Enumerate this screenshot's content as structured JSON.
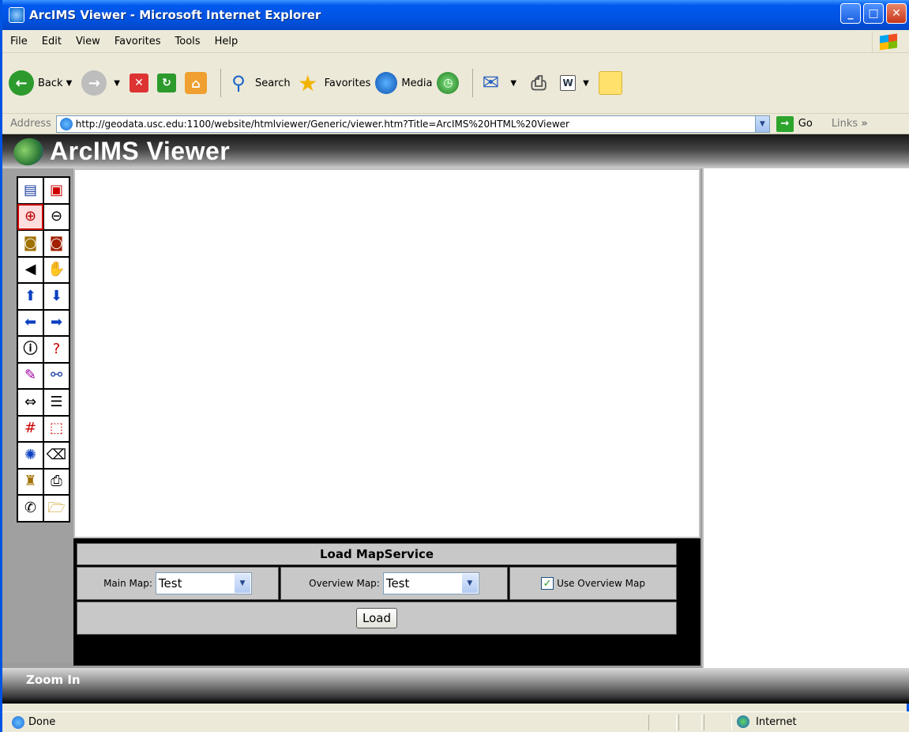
{
  "window": {
    "title": "ArcIMS Viewer - Microsoft Internet Explorer"
  },
  "menu": [
    "File",
    "Edit",
    "View",
    "Favorites",
    "Tools",
    "Help"
  ],
  "toolbar": {
    "back": "Back",
    "search": "Search",
    "favorites": "Favorites",
    "media": "Media"
  },
  "address": {
    "label": "Address",
    "url": "http://geodata.usc.edu:1100/website/htmlviewer/Generic/viewer.htm?Title=ArcIMS%20HTML%20Viewer",
    "go": "Go",
    "links": "Links"
  },
  "viewer": {
    "title": "ArcIMS Viewer",
    "status": "Zoom In"
  },
  "load_panel": {
    "title": "Load MapService",
    "main_map_label": "Main Map:",
    "main_map_value": "Test",
    "overview_map_label": "Overview Map:",
    "overview_map_value": "Test",
    "use_overview_label": "Use Overview Map",
    "use_overview_checked": true,
    "load_button": "Load"
  },
  "status": {
    "text": "Done",
    "zone": "Internet"
  }
}
